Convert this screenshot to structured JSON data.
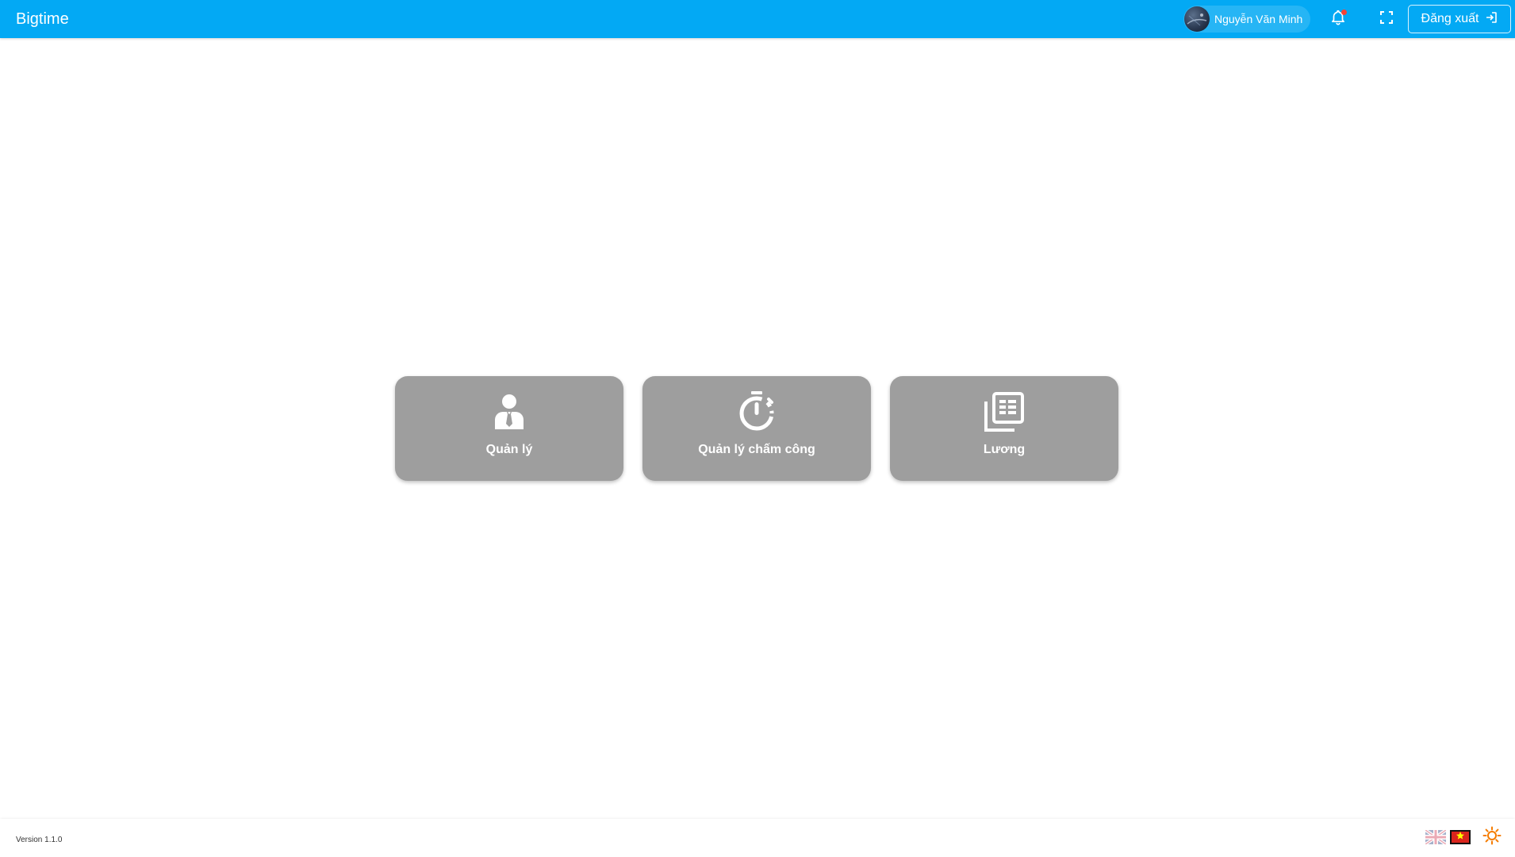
{
  "header": {
    "brand": "Bigtime",
    "user_name": "Nguyễn Văn Minh",
    "logout_label": "Đăng xuất",
    "has_unread_notifications": true
  },
  "tiles": [
    {
      "label": "Quản lý",
      "icon": "manager-person-icon"
    },
    {
      "label": "Quản lý chấm công",
      "icon": "stopwatch-icon"
    },
    {
      "label": "Lương",
      "icon": "payslip-document-icon"
    }
  ],
  "footer": {
    "version": "Version 1.1.0",
    "languages": [
      {
        "code": "en",
        "icon": "uk-flag-icon",
        "active": false
      },
      {
        "code": "vi",
        "icon": "vietnam-flag-icon",
        "active": true
      }
    ],
    "theme_icon": "sun-icon"
  },
  "colors": {
    "header": "#03a9f4",
    "tile": "#9e9e9e",
    "theme_icon": "#f57c00",
    "notification_dot": "#f44336"
  }
}
